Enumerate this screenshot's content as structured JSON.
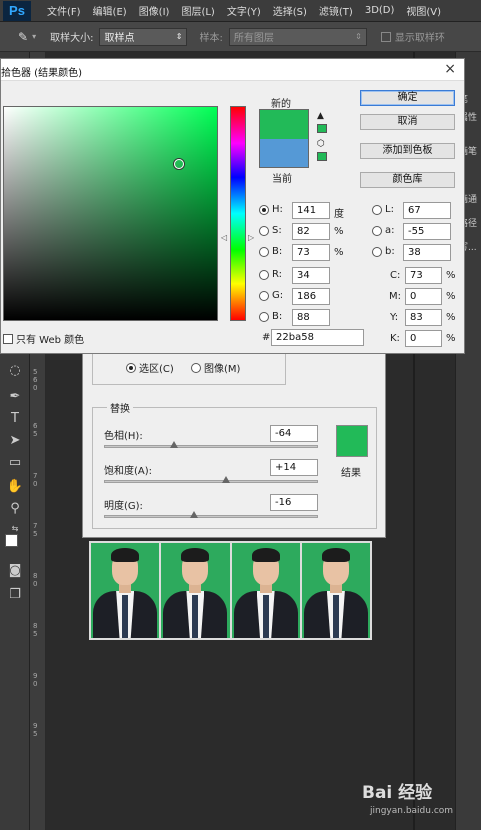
{
  "app": {
    "logo": "Ps"
  },
  "menu": [
    "文件(F)",
    "编辑(E)",
    "图像(I)",
    "图层(L)",
    "文字(Y)",
    "选择(S)",
    "滤镜(T)",
    "3D(D)",
    "视图(V)"
  ],
  "options_bar": {
    "sample_size_label": "取样大小:",
    "sample_size_value": "取样点",
    "sample_label": "样本:",
    "sample_value": "所有图层",
    "show_ring_label": "显示取样环"
  },
  "ruler_numbers": [
    "5",
    "6",
    "0",
    "6",
    "5",
    "7",
    "0",
    "7",
    "5",
    "8",
    "0",
    "8",
    "5",
    "9",
    "0",
    "9",
    "5"
  ],
  "right_panel": [
    "笔",
    "属性",
    "画笔",
    "画通",
    "路径",
    "写..."
  ],
  "color_picker": {
    "title": "拾色器 (结果颜色)",
    "close": "×",
    "new_label": "新的",
    "current_label": "当前",
    "new_color": "#22ba58",
    "current_color": "#5599d6",
    "buttons": {
      "ok": "确定",
      "cancel": "取消",
      "add_to_swatches": "添加到色板",
      "color_libraries": "颜色库"
    },
    "web_only_label": "只有 Web 颜色",
    "fields": {
      "H": {
        "label": "H:",
        "value": "141",
        "unit": "度"
      },
      "S": {
        "label": "S:",
        "value": "82",
        "unit": "%"
      },
      "Bv": {
        "label": "B:",
        "value": "73",
        "unit": "%"
      },
      "R": {
        "label": "R:",
        "value": "34"
      },
      "G": {
        "label": "G:",
        "value": "186"
      },
      "Bc": {
        "label": "B:",
        "value": "88"
      },
      "L": {
        "label": "L:",
        "value": "67"
      },
      "a": {
        "label": "a:",
        "value": "-55"
      },
      "b": {
        "label": "b:",
        "value": "38"
      },
      "C": {
        "label": "C:",
        "value": "73",
        "unit": "%"
      },
      "M": {
        "label": "M:",
        "value": "0",
        "unit": "%"
      },
      "Y": {
        "label": "Y:",
        "value": "83",
        "unit": "%"
      },
      "K": {
        "label": "K:",
        "value": "0",
        "unit": "%"
      },
      "hex": {
        "label": "#",
        "value": "22ba58"
      }
    }
  },
  "hue_saturation": {
    "selection_label": "选区(C)",
    "image_label": "图像(M)",
    "replace_title": "替换",
    "hue_label": "色相(H):",
    "hue_value": "-64",
    "saturation_label": "饱和度(A):",
    "saturation_value": "+14",
    "lightness_label": "明度(G):",
    "lightness_value": "-16",
    "result_label": "结果",
    "result_color": "#22ba58"
  },
  "watermark": {
    "brand": "Bai 经验",
    "url": "jingyan.baidu.com"
  }
}
